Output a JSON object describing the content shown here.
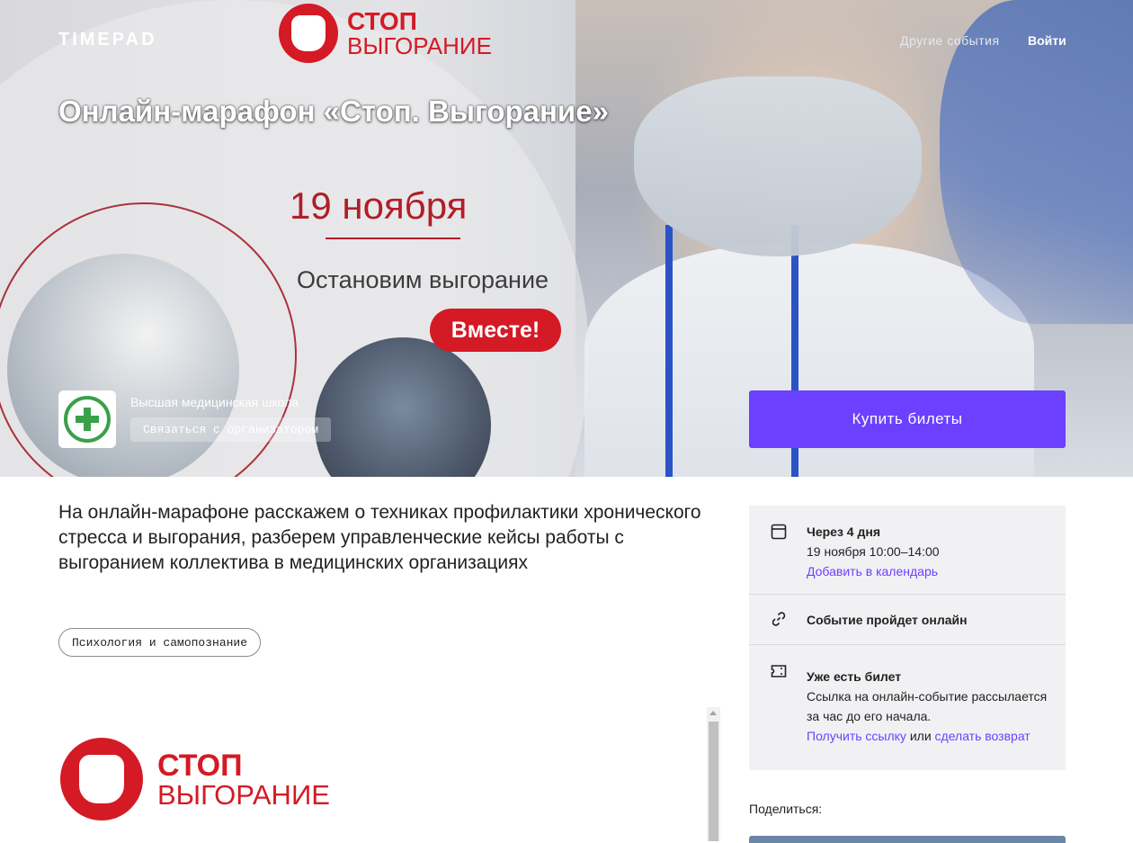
{
  "header": {
    "logo": "TIMEPAD",
    "nav_other_events": "Другие события",
    "nav_login": "Войти"
  },
  "poster": {
    "stop_line1": "СТОП",
    "stop_line2": "ВЫГОРАНИЕ",
    "date": "19 ноября",
    "subtitle": "Остановим выгорание",
    "pill": "Вместе!"
  },
  "event": {
    "title": "Онлайн-марафон «Стоп. Выгорание»",
    "organizer_name": "Высшая медицинская школа",
    "contact_label": "Связаться с организатором",
    "buy_label": "Купить билеты",
    "description": "На онлайн-марафоне расскажем о техниках профилактики хронического стресса и выгорания, разберем управленческие кейсы работы с выгоранием коллектива в медицинских организациях",
    "tag": "Психология и самопознание"
  },
  "embed": {
    "stop_line1": "СТОП",
    "stop_line2": "ВЫГОРАНИЕ"
  },
  "info": {
    "when_title": "Через 4 дня",
    "when_time": "19 ноября 10:00–14:00",
    "add_calendar": "Добавить в календарь",
    "online_title": "Событие пройдет онлайн",
    "ticket_title": "Уже есть билет",
    "ticket_text": "Ссылка на онлайн-событие рассылается за час до его начала.",
    "get_link": "Получить ссылку",
    "or": "или",
    "refund": "сделать возврат"
  },
  "share": {
    "label": "Поделиться:"
  },
  "colors": {
    "accent": "#6b40ff",
    "brand_red": "#d41a24",
    "card_bg": "#f1f1f4"
  }
}
